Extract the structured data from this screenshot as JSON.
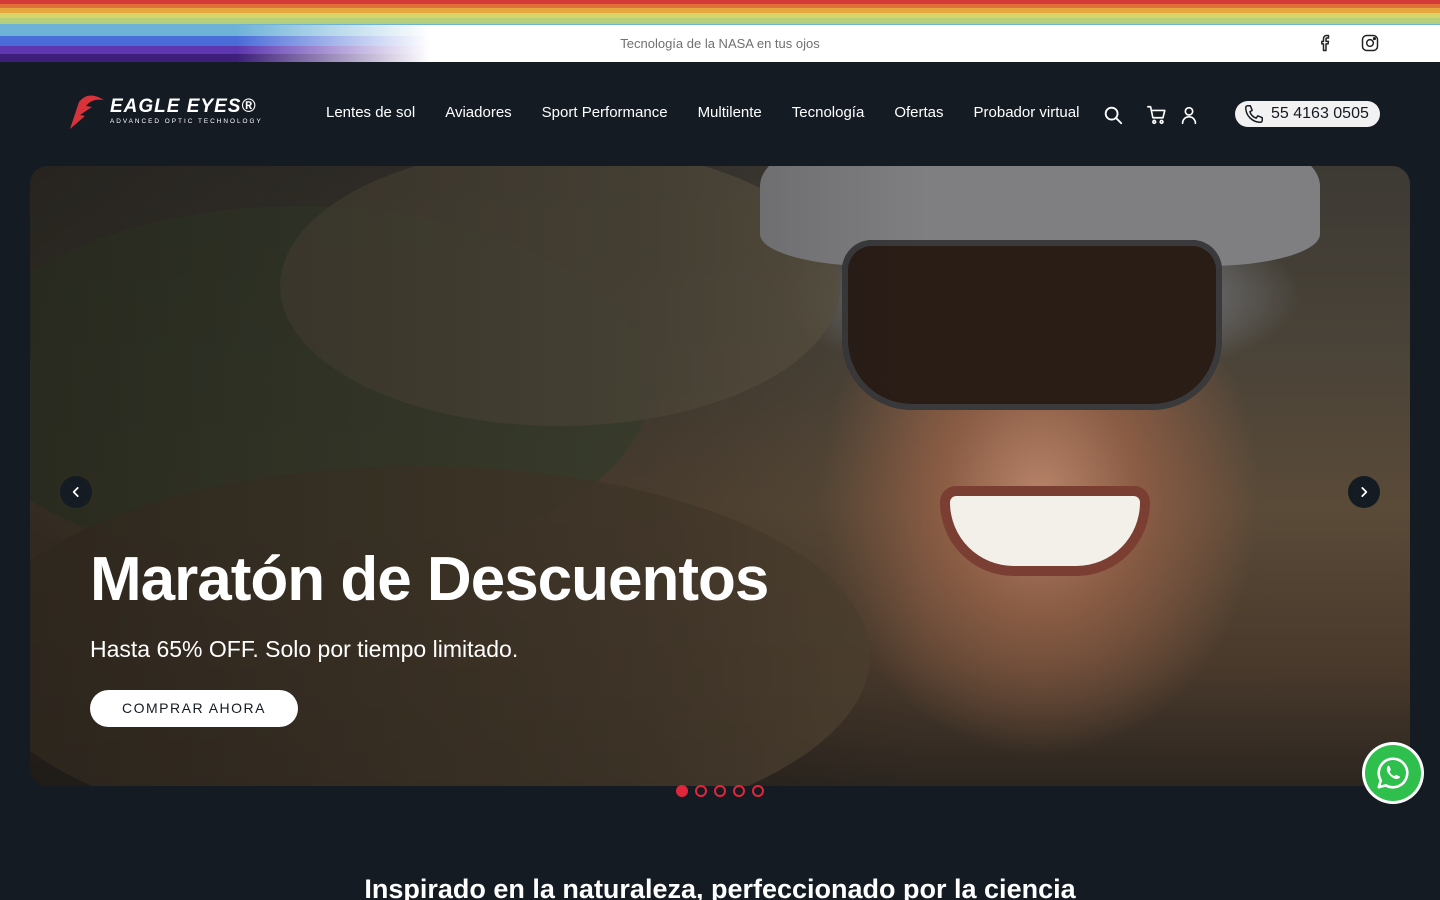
{
  "announcement": {
    "text": "Tecnología de la NASA en tus ojos"
  },
  "social": {
    "facebook_icon": "facebook-icon",
    "instagram_icon": "instagram-icon"
  },
  "header": {
    "logo_text": "EAGLE EYES®",
    "logo_tagline": "ADVANCED OPTIC TECHNOLOGY",
    "nav": [
      {
        "label": "Lentes de sol"
      },
      {
        "label": "Aviadores"
      },
      {
        "label": "Sport Performance"
      },
      {
        "label": "Multilente"
      },
      {
        "label": "Tecnología"
      },
      {
        "label": "Ofertas"
      },
      {
        "label": "Probador virtual"
      }
    ],
    "icons": [
      "search-icon",
      "cart-icon",
      "user-icon"
    ],
    "phone": "55 4163 0505"
  },
  "hero": {
    "title": "Maratón de Descuentos",
    "subtitle": "Hasta 65% OFF. Solo por tiempo limitado.",
    "cta": "COMPRAR AHORA",
    "slide_count": 5,
    "active_slide": 1
  },
  "section": {
    "heading": "Inspirado en la naturaleza, perfeccionado por la ciencia"
  },
  "colors": {
    "accent": "#e0263a",
    "background": "#141b23",
    "whatsapp": "#2fbf4d"
  }
}
